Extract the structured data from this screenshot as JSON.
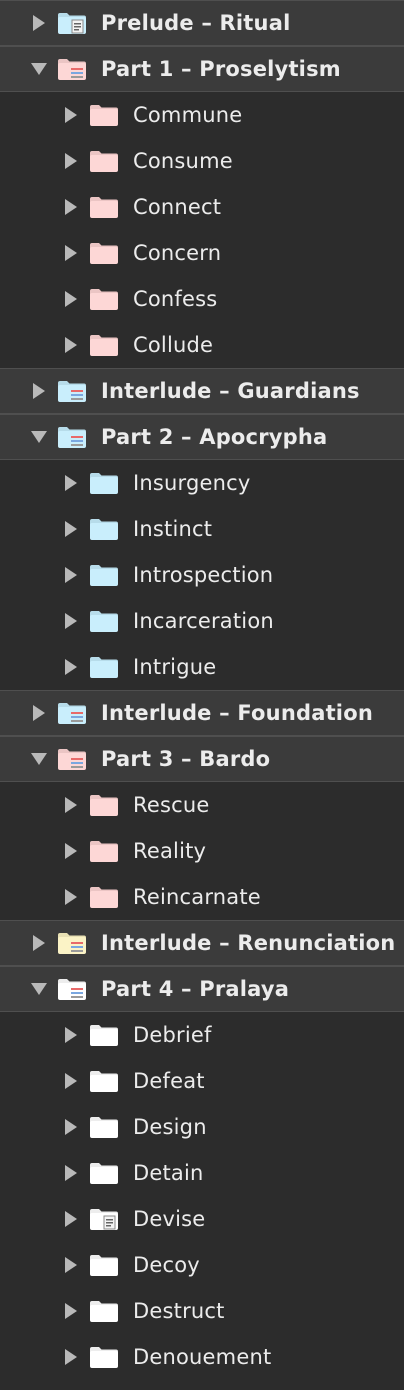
{
  "colors": {
    "background": "#2c2c2c",
    "section_row": "#3b3b3b",
    "separator": "#4f4f4f",
    "text": "#ececec",
    "disclosure": "#b9b9b9",
    "folder_blue": "#c9eefc",
    "folder_pink": "#fdd7d6",
    "folder_yellow": "#fbf3c6",
    "folder_white": "#ffffff"
  },
  "tree": [
    {
      "label": "Prelude – Ritual",
      "level": 0,
      "expanded": false,
      "folder_color": "blue",
      "folder_icon": "folder-doc-icon"
    },
    {
      "label": "Part 1 – Proselytism",
      "level": 0,
      "expanded": true,
      "folder_color": "pink",
      "folder_icon": "folder-lines-icon"
    },
    {
      "label": "Commune",
      "level": 1,
      "expanded": false,
      "folder_color": "pink",
      "folder_icon": "folder-icon"
    },
    {
      "label": "Consume",
      "level": 1,
      "expanded": false,
      "folder_color": "pink",
      "folder_icon": "folder-icon"
    },
    {
      "label": "Connect",
      "level": 1,
      "expanded": false,
      "folder_color": "pink",
      "folder_icon": "folder-icon"
    },
    {
      "label": "Concern",
      "level": 1,
      "expanded": false,
      "folder_color": "pink",
      "folder_icon": "folder-icon"
    },
    {
      "label": "Confess",
      "level": 1,
      "expanded": false,
      "folder_color": "pink",
      "folder_icon": "folder-icon"
    },
    {
      "label": "Collude",
      "level": 1,
      "expanded": false,
      "folder_color": "pink",
      "folder_icon": "folder-icon"
    },
    {
      "label": "Interlude – Guardians",
      "level": 0,
      "expanded": false,
      "folder_color": "blue",
      "folder_icon": "folder-lines-icon"
    },
    {
      "label": "Part 2 – Apocrypha",
      "level": 0,
      "expanded": true,
      "folder_color": "blue",
      "folder_icon": "folder-lines-icon"
    },
    {
      "label": "Insurgency",
      "level": 1,
      "expanded": false,
      "folder_color": "blue",
      "folder_icon": "folder-icon"
    },
    {
      "label": "Instinct",
      "level": 1,
      "expanded": false,
      "folder_color": "blue",
      "folder_icon": "folder-icon"
    },
    {
      "label": "Introspection",
      "level": 1,
      "expanded": false,
      "folder_color": "blue",
      "folder_icon": "folder-icon"
    },
    {
      "label": "Incarceration",
      "level": 1,
      "expanded": false,
      "folder_color": "blue",
      "folder_icon": "folder-icon"
    },
    {
      "label": "Intrigue",
      "level": 1,
      "expanded": false,
      "folder_color": "blue",
      "folder_icon": "folder-icon"
    },
    {
      "label": "Interlude – Foundation",
      "level": 0,
      "expanded": false,
      "folder_color": "blue",
      "folder_icon": "folder-lines-icon"
    },
    {
      "label": "Part 3 – Bardo",
      "level": 0,
      "expanded": true,
      "folder_color": "pink",
      "folder_icon": "folder-lines-icon"
    },
    {
      "label": "Rescue",
      "level": 1,
      "expanded": false,
      "folder_color": "pink",
      "folder_icon": "folder-icon"
    },
    {
      "label": "Reality",
      "level": 1,
      "expanded": false,
      "folder_color": "pink",
      "folder_icon": "folder-icon"
    },
    {
      "label": "Reincarnate",
      "level": 1,
      "expanded": false,
      "folder_color": "pink",
      "folder_icon": "folder-icon"
    },
    {
      "label": "Interlude – Renunciation",
      "level": 0,
      "expanded": false,
      "folder_color": "yellow",
      "folder_icon": "folder-lines-icon"
    },
    {
      "label": "Part 4 – Pralaya",
      "level": 0,
      "expanded": true,
      "folder_color": "white",
      "folder_icon": "folder-lines-icon"
    },
    {
      "label": "Debrief",
      "level": 1,
      "expanded": false,
      "folder_color": "white",
      "folder_icon": "folder-icon"
    },
    {
      "label": "Defeat",
      "level": 1,
      "expanded": false,
      "folder_color": "white",
      "folder_icon": "folder-icon"
    },
    {
      "label": "Design",
      "level": 1,
      "expanded": false,
      "folder_color": "white",
      "folder_icon": "folder-icon"
    },
    {
      "label": "Detain",
      "level": 1,
      "expanded": false,
      "folder_color": "white",
      "folder_icon": "folder-icon"
    },
    {
      "label": "Devise",
      "level": 1,
      "expanded": false,
      "folder_color": "white",
      "folder_icon": "folder-doc-icon"
    },
    {
      "label": "Decoy",
      "level": 1,
      "expanded": false,
      "folder_color": "white",
      "folder_icon": "folder-icon"
    },
    {
      "label": "Destruct",
      "level": 1,
      "expanded": false,
      "folder_color": "white",
      "folder_icon": "folder-icon"
    },
    {
      "label": "Denouement",
      "level": 1,
      "expanded": false,
      "folder_color": "white",
      "folder_icon": "folder-icon"
    }
  ]
}
